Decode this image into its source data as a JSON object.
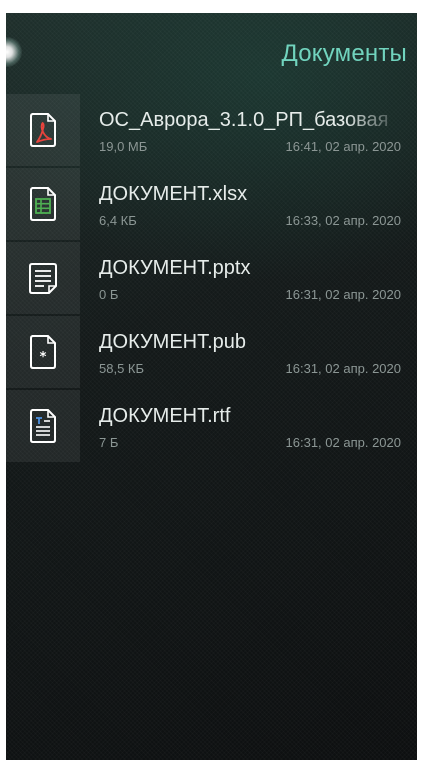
{
  "header": {
    "title": "Документы"
  },
  "files": [
    {
      "name": "ОС_Аврора_3.1.0_РП_базовая",
      "size": "19,0 МБ",
      "date": "16:41, 02 апр. 2020",
      "icon": "pdf-file-icon"
    },
    {
      "name": "ДОКУМЕНТ.xlsx",
      "size": "6,4 КБ",
      "date": "16:33, 02 апр. 2020",
      "icon": "spreadsheet-file-icon"
    },
    {
      "name": "ДОКУМЕНТ.pptx",
      "size": "0 Б",
      "date": "16:31, 02 апр. 2020",
      "icon": "presentation-file-icon"
    },
    {
      "name": "ДОКУМЕНТ.pub",
      "size": "58,5 КБ",
      "date": "16:31, 02 апр. 2020",
      "icon": "generic-file-icon"
    },
    {
      "name": "ДОКУМЕНТ.rtf",
      "size": "7 Б",
      "date": "16:31, 02 апр. 2020",
      "icon": "text-document-icon"
    }
  ],
  "colors": {
    "accent": "#6fd3bd",
    "primary_text": "#e6ecea",
    "secondary_text": "#8a9593"
  }
}
